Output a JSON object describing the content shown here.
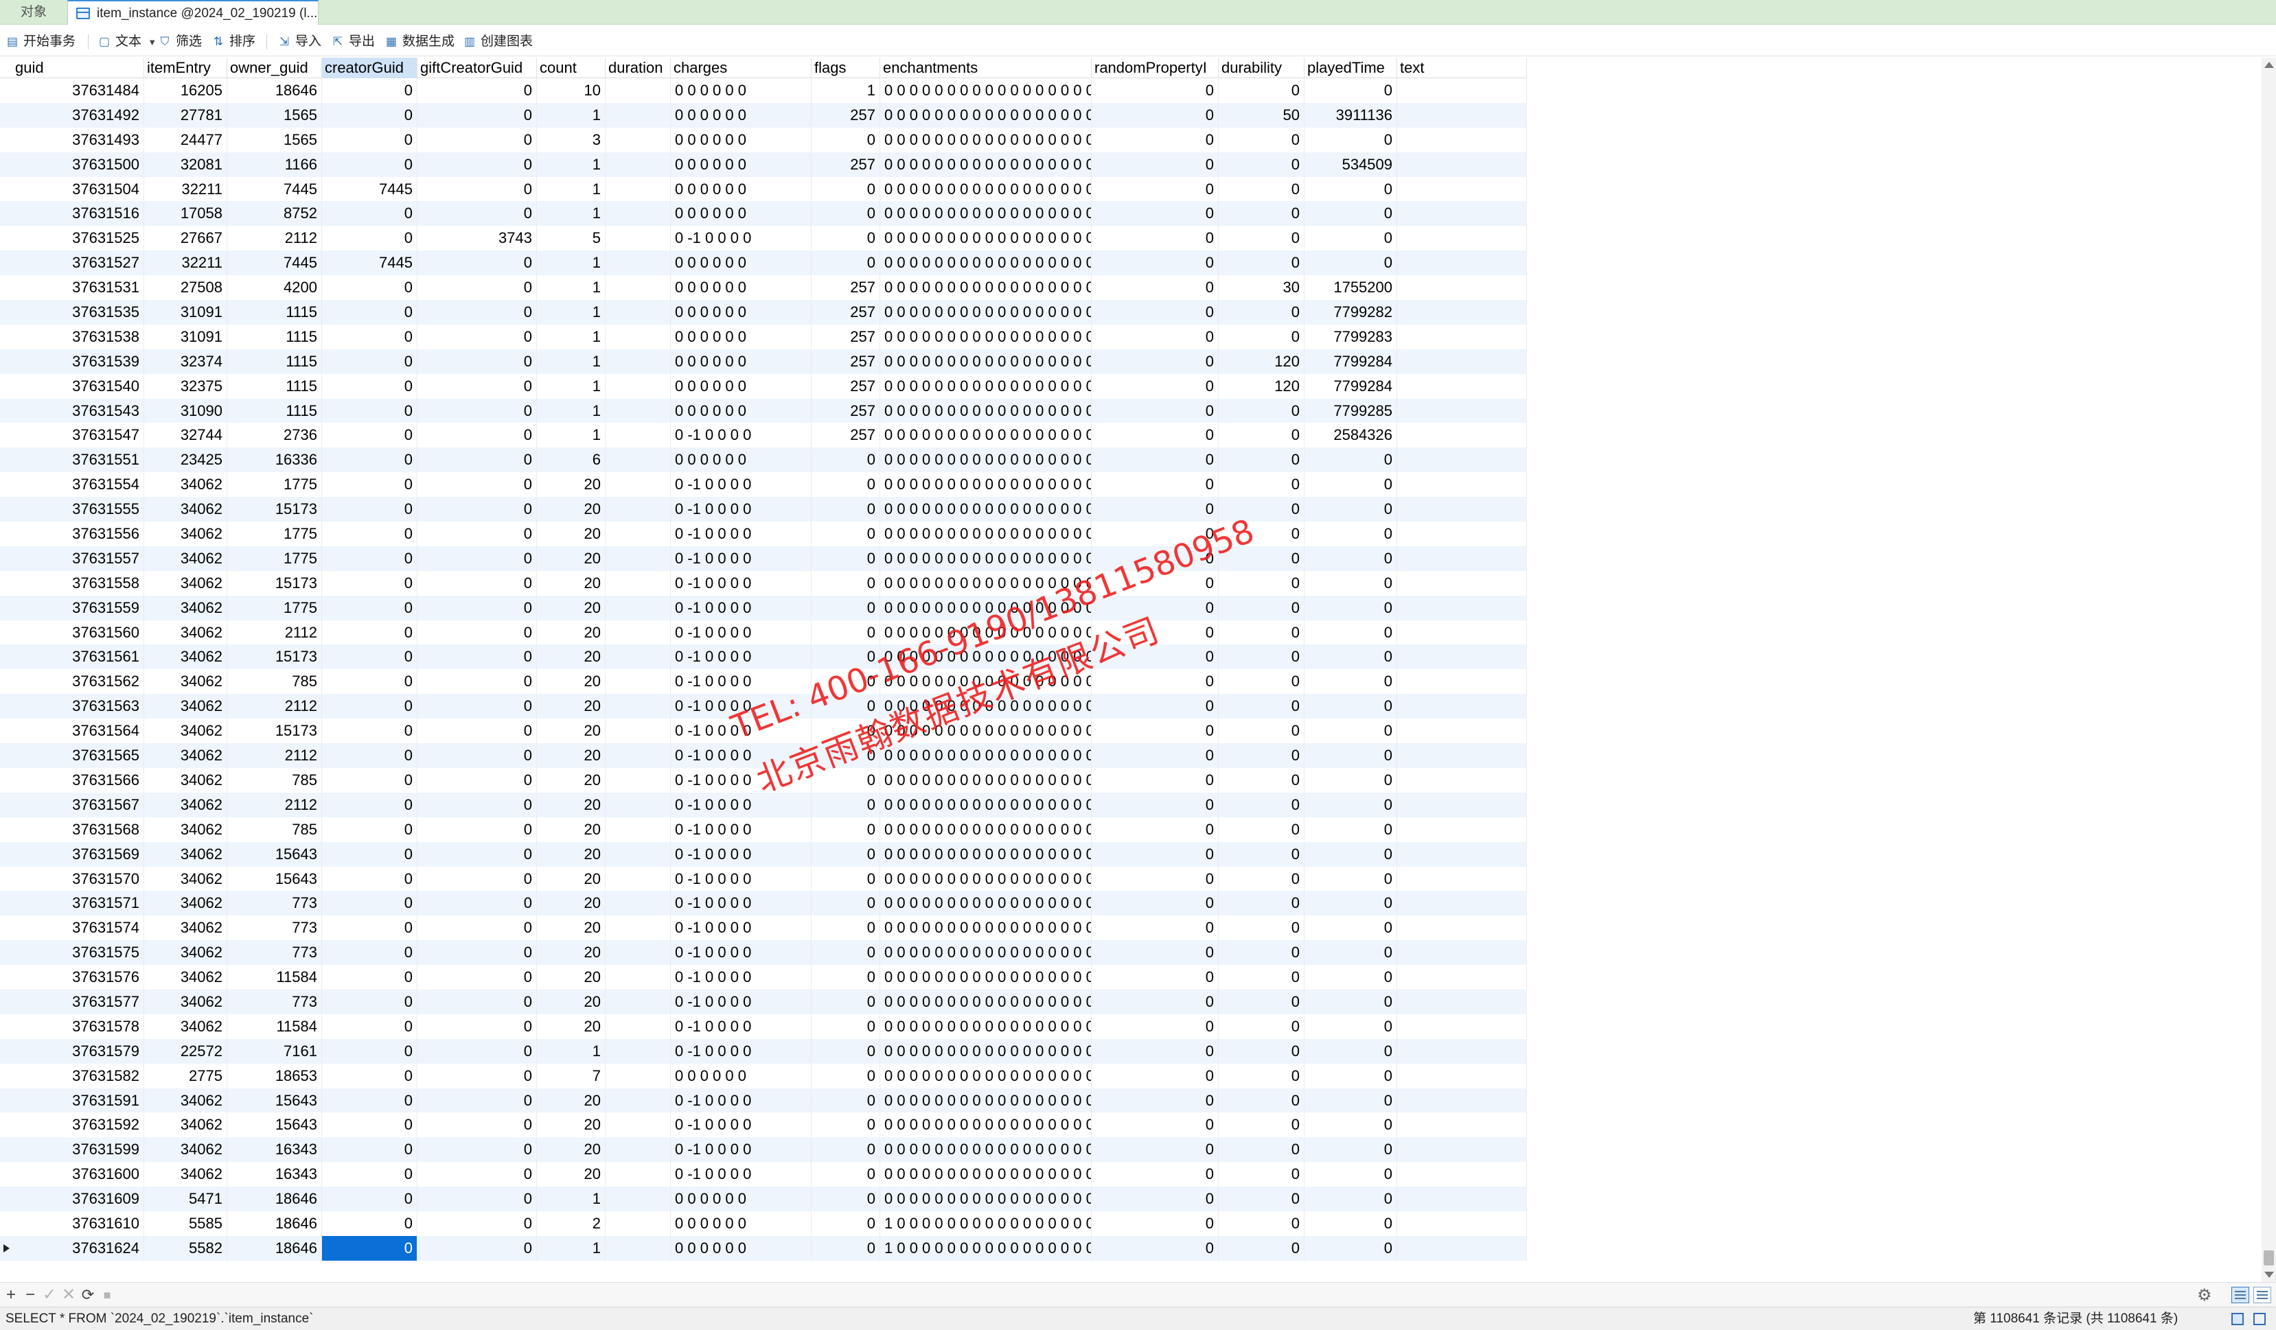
{
  "tabs": {
    "objects_label": "对象",
    "active_label": "item_instance @2024_02_190219 (l..."
  },
  "toolbar": {
    "begin_transaction": "开始事务",
    "text": "文本",
    "filter": "筛选",
    "sort": "排序",
    "import": "导入",
    "export": "导出",
    "data_generation": "数据生成",
    "create_chart": "创建图表"
  },
  "columns": [
    {
      "key": "guid",
      "label": "guid",
      "align": "right"
    },
    {
      "key": "itemEntry",
      "label": "itemEntry",
      "align": "right"
    },
    {
      "key": "owner_guid",
      "label": "owner_guid",
      "align": "right"
    },
    {
      "key": "creatorGuid",
      "label": "creatorGuid",
      "align": "right"
    },
    {
      "key": "giftCreatorGuid",
      "label": "giftCreatorGuid",
      "align": "right"
    },
    {
      "key": "count",
      "label": "count",
      "align": "right"
    },
    {
      "key": "duration",
      "label": "duration",
      "align": "right"
    },
    {
      "key": "charges",
      "label": "charges",
      "align": "left"
    },
    {
      "key": "flags",
      "label": "flags",
      "align": "right"
    },
    {
      "key": "enchantments",
      "label": "enchantments",
      "align": "left"
    },
    {
      "key": "randomPropertyId",
      "label": "randomPropertyI",
      "align": "right"
    },
    {
      "key": "durability",
      "label": "durability",
      "align": "right"
    },
    {
      "key": "playedTime",
      "label": "playedTime",
      "align": "right"
    },
    {
      "key": "text",
      "label": "text",
      "align": "left"
    }
  ],
  "selected_column": "creatorGuid",
  "current_row_index": 47,
  "rows": [
    [
      "37631484",
      "16205",
      "18646",
      "0",
      "0",
      "10",
      "",
      "0 0 0 0 0 0",
      "1",
      "0 0 0 0 0 0 0 0 0 0 0 0 0 0 0 0 0 (",
      "0",
      "0",
      "0",
      ""
    ],
    [
      "37631492",
      "27781",
      "1565",
      "0",
      "0",
      "1",
      "",
      "0 0 0 0 0 0",
      "257",
      "0 0 0 0 0 0 0 0 0 0 0 0 0 0 0 0 0 (",
      "0",
      "50",
      "3911136",
      ""
    ],
    [
      "37631493",
      "24477",
      "1565",
      "0",
      "0",
      "3",
      "",
      "0 0 0 0 0 0",
      "0",
      "0 0 0 0 0 0 0 0 0 0 0 0 0 0 0 0 0 (",
      "0",
      "0",
      "0",
      ""
    ],
    [
      "37631500",
      "32081",
      "1166",
      "0",
      "0",
      "1",
      "",
      "0 0 0 0 0 0",
      "257",
      "0 0 0 0 0 0 0 0 0 0 0 0 0 0 0 0 0 (",
      "0",
      "0",
      "534509",
      ""
    ],
    [
      "37631504",
      "32211",
      "7445",
      "7445",
      "0",
      "1",
      "",
      "0 0 0 0 0 0",
      "0",
      "0 0 0 0 0 0 0 0 0 0 0 0 0 0 0 0 0 (",
      "0",
      "0",
      "0",
      ""
    ],
    [
      "37631516",
      "17058",
      "8752",
      "0",
      "0",
      "1",
      "",
      "0 0 0 0 0 0",
      "0",
      "0 0 0 0 0 0 0 0 0 0 0 0 0 0 0 0 0 (",
      "0",
      "0",
      "0",
      ""
    ],
    [
      "37631525",
      "27667",
      "2112",
      "0",
      "3743",
      "5",
      "",
      "0 -1 0 0 0 0",
      "0",
      "0 0 0 0 0 0 0 0 0 0 0 0 0 0 0 0 0 (",
      "0",
      "0",
      "0",
      ""
    ],
    [
      "37631527",
      "32211",
      "7445",
      "7445",
      "0",
      "1",
      "",
      "0 0 0 0 0 0",
      "0",
      "0 0 0 0 0 0 0 0 0 0 0 0 0 0 0 0 0 (",
      "0",
      "0",
      "0",
      ""
    ],
    [
      "37631531",
      "27508",
      "4200",
      "0",
      "0",
      "1",
      "",
      "0 0 0 0 0 0",
      "257",
      "0 0 0 0 0 0 0 0 0 0 0 0 0 0 0 0 0 (",
      "0",
      "30",
      "1755200",
      ""
    ],
    [
      "37631535",
      "31091",
      "1115",
      "0",
      "0",
      "1",
      "",
      "0 0 0 0 0 0",
      "257",
      "0 0 0 0 0 0 0 0 0 0 0 0 0 0 0 0 0 (",
      "0",
      "0",
      "7799282",
      ""
    ],
    [
      "37631538",
      "31091",
      "1115",
      "0",
      "0",
      "1",
      "",
      "0 0 0 0 0 0",
      "257",
      "0 0 0 0 0 0 0 0 0 0 0 0 0 0 0 0 0 (",
      "0",
      "0",
      "7799283",
      ""
    ],
    [
      "37631539",
      "32374",
      "1115",
      "0",
      "0",
      "1",
      "",
      "0 0 0 0 0 0",
      "257",
      "0 0 0 0 0 0 0 0 0 0 0 0 0 0 0 0 0 (",
      "0",
      "120",
      "7799284",
      ""
    ],
    [
      "37631540",
      "32375",
      "1115",
      "0",
      "0",
      "1",
      "",
      "0 0 0 0 0 0",
      "257",
      "0 0 0 0 0 0 0 0 0 0 0 0 0 0 0 0 0 (",
      "0",
      "120",
      "7799284",
      ""
    ],
    [
      "37631543",
      "31090",
      "1115",
      "0",
      "0",
      "1",
      "",
      "0 0 0 0 0 0",
      "257",
      "0 0 0 0 0 0 0 0 0 0 0 0 0 0 0 0 0 (",
      "0",
      "0",
      "7799285",
      ""
    ],
    [
      "37631547",
      "32744",
      "2736",
      "0",
      "0",
      "1",
      "",
      "0 -1 0 0 0 0",
      "257",
      "0 0 0 0 0 0 0 0 0 0 0 0 0 0 0 0 0 (",
      "0",
      "0",
      "2584326",
      ""
    ],
    [
      "37631551",
      "23425",
      "16336",
      "0",
      "0",
      "6",
      "",
      "0 0 0 0 0 0",
      "0",
      "0 0 0 0 0 0 0 0 0 0 0 0 0 0 0 0 0 (",
      "0",
      "0",
      "0",
      ""
    ],
    [
      "37631554",
      "34062",
      "1775",
      "0",
      "0",
      "20",
      "",
      "0 -1 0 0 0 0",
      "0",
      "0 0 0 0 0 0 0 0 0 0 0 0 0 0 0 0 0 (",
      "0",
      "0",
      "0",
      ""
    ],
    [
      "37631555",
      "34062",
      "15173",
      "0",
      "0",
      "20",
      "",
      "0 -1 0 0 0 0",
      "0",
      "0 0 0 0 0 0 0 0 0 0 0 0 0 0 0 0 0 (",
      "0",
      "0",
      "0",
      ""
    ],
    [
      "37631556",
      "34062",
      "1775",
      "0",
      "0",
      "20",
      "",
      "0 -1 0 0 0 0",
      "0",
      "0 0 0 0 0 0 0 0 0 0 0 0 0 0 0 0 0 (",
      "0",
      "0",
      "0",
      ""
    ],
    [
      "37631557",
      "34062",
      "1775",
      "0",
      "0",
      "20",
      "",
      "0 -1 0 0 0 0",
      "0",
      "0 0 0 0 0 0 0 0 0 0 0 0 0 0 0 0 0 (",
      "0",
      "0",
      "0",
      ""
    ],
    [
      "37631558",
      "34062",
      "15173",
      "0",
      "0",
      "20",
      "",
      "0 -1 0 0 0 0",
      "0",
      "0 0 0 0 0 0 0 0 0 0 0 0 0 0 0 0 0 (",
      "0",
      "0",
      "0",
      ""
    ],
    [
      "37631559",
      "34062",
      "1775",
      "0",
      "0",
      "20",
      "",
      "0 -1 0 0 0 0",
      "0",
      "0 0 0 0 0 0 0 0 0 0 0 0 0 0 0 0 0 (",
      "0",
      "0",
      "0",
      ""
    ],
    [
      "37631560",
      "34062",
      "2112",
      "0",
      "0",
      "20",
      "",
      "0 -1 0 0 0 0",
      "0",
      "0 0 0 0 0 0 0 0 0 0 0 0 0 0 0 0 0 (",
      "0",
      "0",
      "0",
      ""
    ],
    [
      "37631561",
      "34062",
      "15173",
      "0",
      "0",
      "20",
      "",
      "0 -1 0 0 0 0",
      "0",
      "0 0 0 0 0 0 0 0 0 0 0 0 0 0 0 0 0 (",
      "0",
      "0",
      "0",
      ""
    ],
    [
      "37631562",
      "34062",
      "785",
      "0",
      "0",
      "20",
      "",
      "0 -1 0 0 0 0",
      "0",
      "0 0 0 0 0 0 0 0 0 0 0 0 0 0 0 0 0 (",
      "0",
      "0",
      "0",
      ""
    ],
    [
      "37631563",
      "34062",
      "2112",
      "0",
      "0",
      "20",
      "",
      "0 -1 0 0 0 0",
      "0",
      "0 0 0 0 0 0 0 0 0 0 0 0 0 0 0 0 0 (",
      "0",
      "0",
      "0",
      ""
    ],
    [
      "37631564",
      "34062",
      "15173",
      "0",
      "0",
      "20",
      "",
      "0 -1 0 0 0 0",
      "0",
      "0 0 0 0 0 0 0 0 0 0 0 0 0 0 0 0 0 (",
      "0",
      "0",
      "0",
      ""
    ],
    [
      "37631565",
      "34062",
      "2112",
      "0",
      "0",
      "20",
      "",
      "0 -1 0 0 0 0",
      "0",
      "0 0 0 0 0 0 0 0 0 0 0 0 0 0 0 0 0 (",
      "0",
      "0",
      "0",
      ""
    ],
    [
      "37631566",
      "34062",
      "785",
      "0",
      "0",
      "20",
      "",
      "0 -1 0 0 0 0",
      "0",
      "0 0 0 0 0 0 0 0 0 0 0 0 0 0 0 0 0 (",
      "0",
      "0",
      "0",
      ""
    ],
    [
      "37631567",
      "34062",
      "2112",
      "0",
      "0",
      "20",
      "",
      "0 -1 0 0 0 0",
      "0",
      "0 0 0 0 0 0 0 0 0 0 0 0 0 0 0 0 0 (",
      "0",
      "0",
      "0",
      ""
    ],
    [
      "37631568",
      "34062",
      "785",
      "0",
      "0",
      "20",
      "",
      "0 -1 0 0 0 0",
      "0",
      "0 0 0 0 0 0 0 0 0 0 0 0 0 0 0 0 0 (",
      "0",
      "0",
      "0",
      ""
    ],
    [
      "37631569",
      "34062",
      "15643",
      "0",
      "0",
      "20",
      "",
      "0 -1 0 0 0 0",
      "0",
      "0 0 0 0 0 0 0 0 0 0 0 0 0 0 0 0 0 (",
      "0",
      "0",
      "0",
      ""
    ],
    [
      "37631570",
      "34062",
      "15643",
      "0",
      "0",
      "20",
      "",
      "0 -1 0 0 0 0",
      "0",
      "0 0 0 0 0 0 0 0 0 0 0 0 0 0 0 0 0 (",
      "0",
      "0",
      "0",
      ""
    ],
    [
      "37631571",
      "34062",
      "773",
      "0",
      "0",
      "20",
      "",
      "0 -1 0 0 0 0",
      "0",
      "0 0 0 0 0 0 0 0 0 0 0 0 0 0 0 0 0 (",
      "0",
      "0",
      "0",
      ""
    ],
    [
      "37631574",
      "34062",
      "773",
      "0",
      "0",
      "20",
      "",
      "0 -1 0 0 0 0",
      "0",
      "0 0 0 0 0 0 0 0 0 0 0 0 0 0 0 0 0 (",
      "0",
      "0",
      "0",
      ""
    ],
    [
      "37631575",
      "34062",
      "773",
      "0",
      "0",
      "20",
      "",
      "0 -1 0 0 0 0",
      "0",
      "0 0 0 0 0 0 0 0 0 0 0 0 0 0 0 0 0 (",
      "0",
      "0",
      "0",
      ""
    ],
    [
      "37631576",
      "34062",
      "11584",
      "0",
      "0",
      "20",
      "",
      "0 -1 0 0 0 0",
      "0",
      "0 0 0 0 0 0 0 0 0 0 0 0 0 0 0 0 0 (",
      "0",
      "0",
      "0",
      ""
    ],
    [
      "37631577",
      "34062",
      "773",
      "0",
      "0",
      "20",
      "",
      "0 -1 0 0 0 0",
      "0",
      "0 0 0 0 0 0 0 0 0 0 0 0 0 0 0 0 0 (",
      "0",
      "0",
      "0",
      ""
    ],
    [
      "37631578",
      "34062",
      "11584",
      "0",
      "0",
      "20",
      "",
      "0 -1 0 0 0 0",
      "0",
      "0 0 0 0 0 0 0 0 0 0 0 0 0 0 0 0 0 (",
      "0",
      "0",
      "0",
      ""
    ],
    [
      "37631579",
      "22572",
      "7161",
      "0",
      "0",
      "1",
      "",
      "0 -1 0 0 0 0",
      "0",
      "0 0 0 0 0 0 0 0 0 0 0 0 0 0 0 0 0 (",
      "0",
      "0",
      "0",
      ""
    ],
    [
      "37631582",
      "2775",
      "18653",
      "0",
      "0",
      "7",
      "",
      "0 0 0 0 0 0",
      "0",
      "0 0 0 0 0 0 0 0 0 0 0 0 0 0 0 0 0 (",
      "0",
      "0",
      "0",
      ""
    ],
    [
      "37631591",
      "34062",
      "15643",
      "0",
      "0",
      "20",
      "",
      "0 -1 0 0 0 0",
      "0",
      "0 0 0 0 0 0 0 0 0 0 0 0 0 0 0 0 0 (",
      "0",
      "0",
      "0",
      ""
    ],
    [
      "37631592",
      "34062",
      "15643",
      "0",
      "0",
      "20",
      "",
      "0 -1 0 0 0 0",
      "0",
      "0 0 0 0 0 0 0 0 0 0 0 0 0 0 0 0 0 (",
      "0",
      "0",
      "0",
      ""
    ],
    [
      "37631599",
      "34062",
      "16343",
      "0",
      "0",
      "20",
      "",
      "0 -1 0 0 0 0",
      "0",
      "0 0 0 0 0 0 0 0 0 0 0 0 0 0 0 0 0 (",
      "0",
      "0",
      "0",
      ""
    ],
    [
      "37631600",
      "34062",
      "16343",
      "0",
      "0",
      "20",
      "",
      "0 -1 0 0 0 0",
      "0",
      "0 0 0 0 0 0 0 0 0 0 0 0 0 0 0 0 0 (",
      "0",
      "0",
      "0",
      ""
    ],
    [
      "37631609",
      "5471",
      "18646",
      "0",
      "0",
      "1",
      "",
      "0 0 0 0 0 0",
      "0",
      "0 0 0 0 0 0 0 0 0 0 0 0 0 0 0 0 0 (",
      "0",
      "0",
      "0",
      ""
    ],
    [
      "37631610",
      "5585",
      "18646",
      "0",
      "0",
      "2",
      "",
      "0 0 0 0 0 0",
      "0",
      "1 0 0 0 0 0 0 0 0 0 0 0 0 0 0 0 0 (",
      "0",
      "0",
      "0",
      ""
    ],
    [
      "37631624",
      "5582",
      "18646",
      "0",
      "0",
      "1",
      "",
      "0 0 0 0 0 0",
      "0",
      "1 0 0 0 0 0 0 0 0 0 0 0 0 0 0 0 0 (",
      "0",
      "0",
      "0",
      ""
    ]
  ],
  "status": {
    "sql": "SELECT * FROM `2024_02_190219`.`item_instance`",
    "record_info": "第 1108641 条记录 (共 1108641 条)"
  },
  "watermark": {
    "line1": "TEL: 400-166-9190/13811580958",
    "line2": "北京雨翰数据技术有限公司",
    "color": "#ee1c1c"
  },
  "colors": {
    "tabbar_bg": "#d7ebd5",
    "selection_blue": "#0a6fd6",
    "alt_row": "#eef5fc"
  }
}
